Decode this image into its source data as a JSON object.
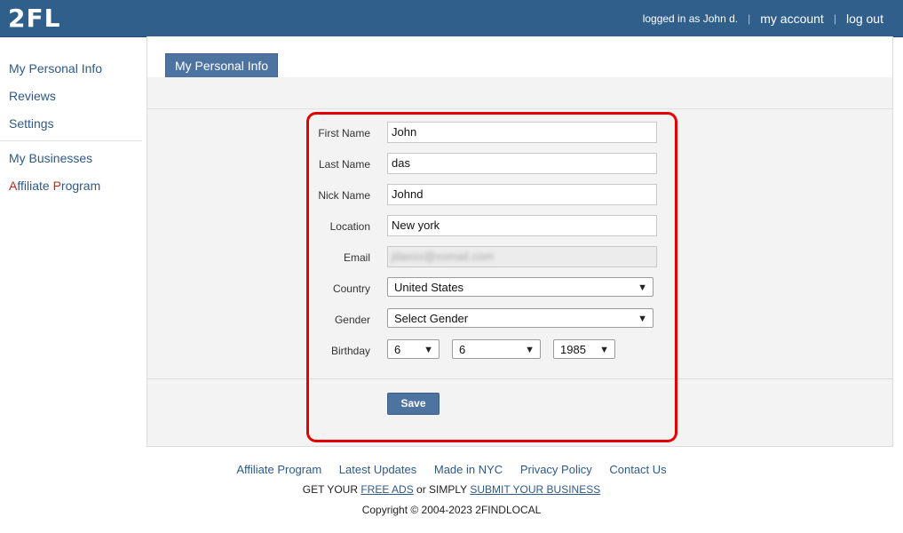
{
  "header": {
    "logo": "2FL",
    "logged_in": "logged in as John d.",
    "separator": "|",
    "my_account": "my account",
    "log_out": "log out"
  },
  "sidebar": {
    "items": [
      {
        "label": "My Personal Info"
      },
      {
        "label": "Reviews"
      },
      {
        "label": "Settings"
      }
    ],
    "items2": [
      {
        "label": "My Businesses"
      }
    ],
    "affiliate": {
      "a": "A",
      "ffiliate": "ffiliate ",
      "p": "P",
      "rogram": "rogram"
    }
  },
  "tab": {
    "label": "My Personal Info"
  },
  "form": {
    "first_name": {
      "label": "First Name",
      "value": "John"
    },
    "last_name": {
      "label": "Last Name",
      "value": "das"
    },
    "nick_name": {
      "label": "Nick Name",
      "value": "Johnd"
    },
    "location": {
      "label": "Location",
      "value": "New york"
    },
    "email": {
      "label": "Email",
      "value": "jdaxxx@xxmail.com"
    },
    "country": {
      "label": "Country",
      "value": "United States"
    },
    "gender": {
      "label": "Gender",
      "value": "Select Gender"
    },
    "birthday": {
      "label": "Birthday",
      "month": "6",
      "day": "6",
      "year": "1985"
    },
    "save_label": "Save"
  },
  "footer": {
    "links": [
      "Affiliate Program",
      "Latest Updates",
      "Made in NYC",
      "Privacy Policy",
      "Contact Us"
    ],
    "get_your": "GET YOUR",
    "free_ads": "FREE ADS",
    "or_simply": "or SIMPLY",
    "submit": "SUBMIT YOUR BUSINESS",
    "copyright": "Copyright © 2004-2023 2FINDLOCAL"
  },
  "colors": {
    "header_bg": "#2f5f8a",
    "accent": "#4d74a0",
    "highlight": "#e40000"
  }
}
